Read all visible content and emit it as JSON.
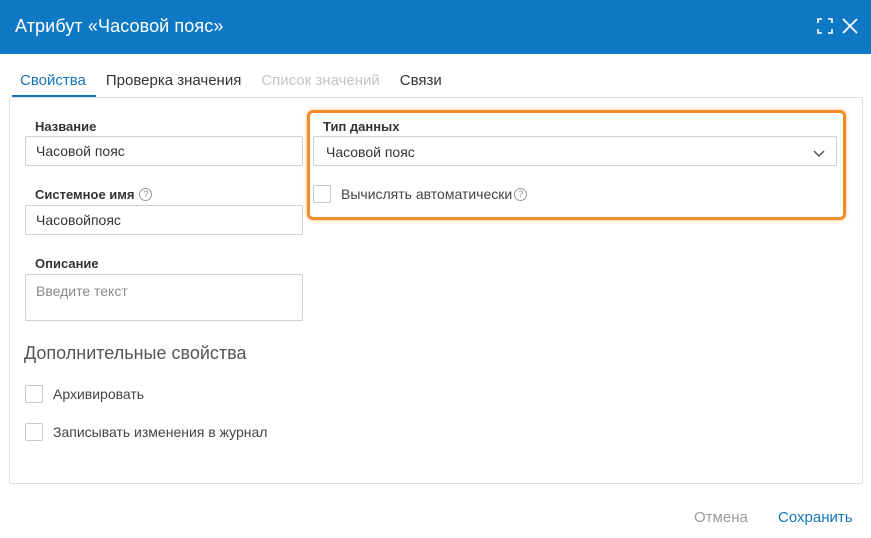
{
  "dialog": {
    "title": "Атрибут «Часовой пояс»",
    "accent_color": "#0f78c5",
    "highlight_color": "#f28c28",
    "controls": [
      "expand-icon",
      "close-icon"
    ]
  },
  "tabs": [
    {
      "label": "Свойства",
      "state": "active"
    },
    {
      "label": "Проверка значения",
      "state": "normal"
    },
    {
      "label": "Список значений",
      "state": "disabled"
    },
    {
      "label": "Связи",
      "state": "normal"
    }
  ],
  "form": {
    "name": {
      "label": "Название",
      "value": "Часовой пояс"
    },
    "system_name": {
      "label": "Системное имя",
      "value": "Часовойпояс",
      "help_icon": "question-circle-icon"
    },
    "description": {
      "label": "Описание",
      "placeholder": "Введите текст"
    },
    "data_type": {
      "label": "Тип данных",
      "selected": "Часовой пояс",
      "icon": "chevron-down-icon"
    },
    "auto_calc": {
      "label": "Вычислять автоматически",
      "checked": false,
      "help_icon": "question-circle-icon"
    }
  },
  "additional": {
    "title": "Дополнительные свойства",
    "options": [
      {
        "label": "Архивировать",
        "checked": false
      },
      {
        "label": "Записывать изменения в журнал",
        "checked": false
      }
    ]
  },
  "footer": {
    "cancel_label": "Отмена",
    "save_label": "Сохранить"
  }
}
